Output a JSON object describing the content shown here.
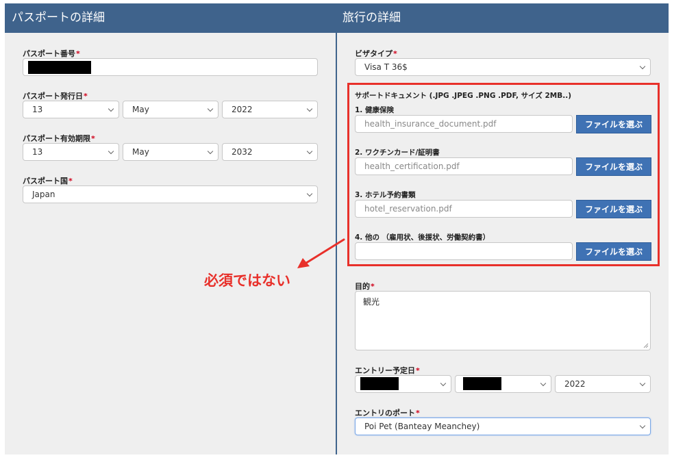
{
  "header": {
    "left_title": "パスポートの詳細",
    "right_title": "旅行の詳細"
  },
  "passport": {
    "number_label": "パスポート番号",
    "issue_label": "パスポート発行日",
    "issue_day": "13",
    "issue_month": "May",
    "issue_year": "2022",
    "expiry_label": "パスポート有効期限",
    "expiry_day": "13",
    "expiry_month": "May",
    "expiry_year": "2032",
    "country_label": "パスポート国",
    "country_value": "Japan"
  },
  "travel": {
    "visa_label": "ビザタイプ",
    "visa_value": "Visa T 36$",
    "docs_title": "サポートドキュメント (.JPG .JPEG .PNG .PDF, サイズ 2MB..)",
    "docs": [
      {
        "label": "1. 健康保険",
        "value": "health_insurance_document.pdf"
      },
      {
        "label": "2. ワクチンカード/証明書",
        "value": "health_certification.pdf"
      },
      {
        "label": "3. ホテル予約書類",
        "value": "hotel_reservation.pdf"
      },
      {
        "label": "4. 他の （雇用状、後援状、労働契約書）",
        "value": ""
      }
    ],
    "file_button_label": "ファイルを選ぶ",
    "purpose_label": "目的",
    "purpose_value": "観光",
    "entry_date_label": "エントリー予定日",
    "entry_year": "2022",
    "entry_port_label": "エントリのポート",
    "entry_port_value": "Poi Pet (Banteay Meanchey)"
  },
  "annotation": {
    "text": "必須ではない",
    "color": "#e8302a"
  },
  "required_mark": "*"
}
